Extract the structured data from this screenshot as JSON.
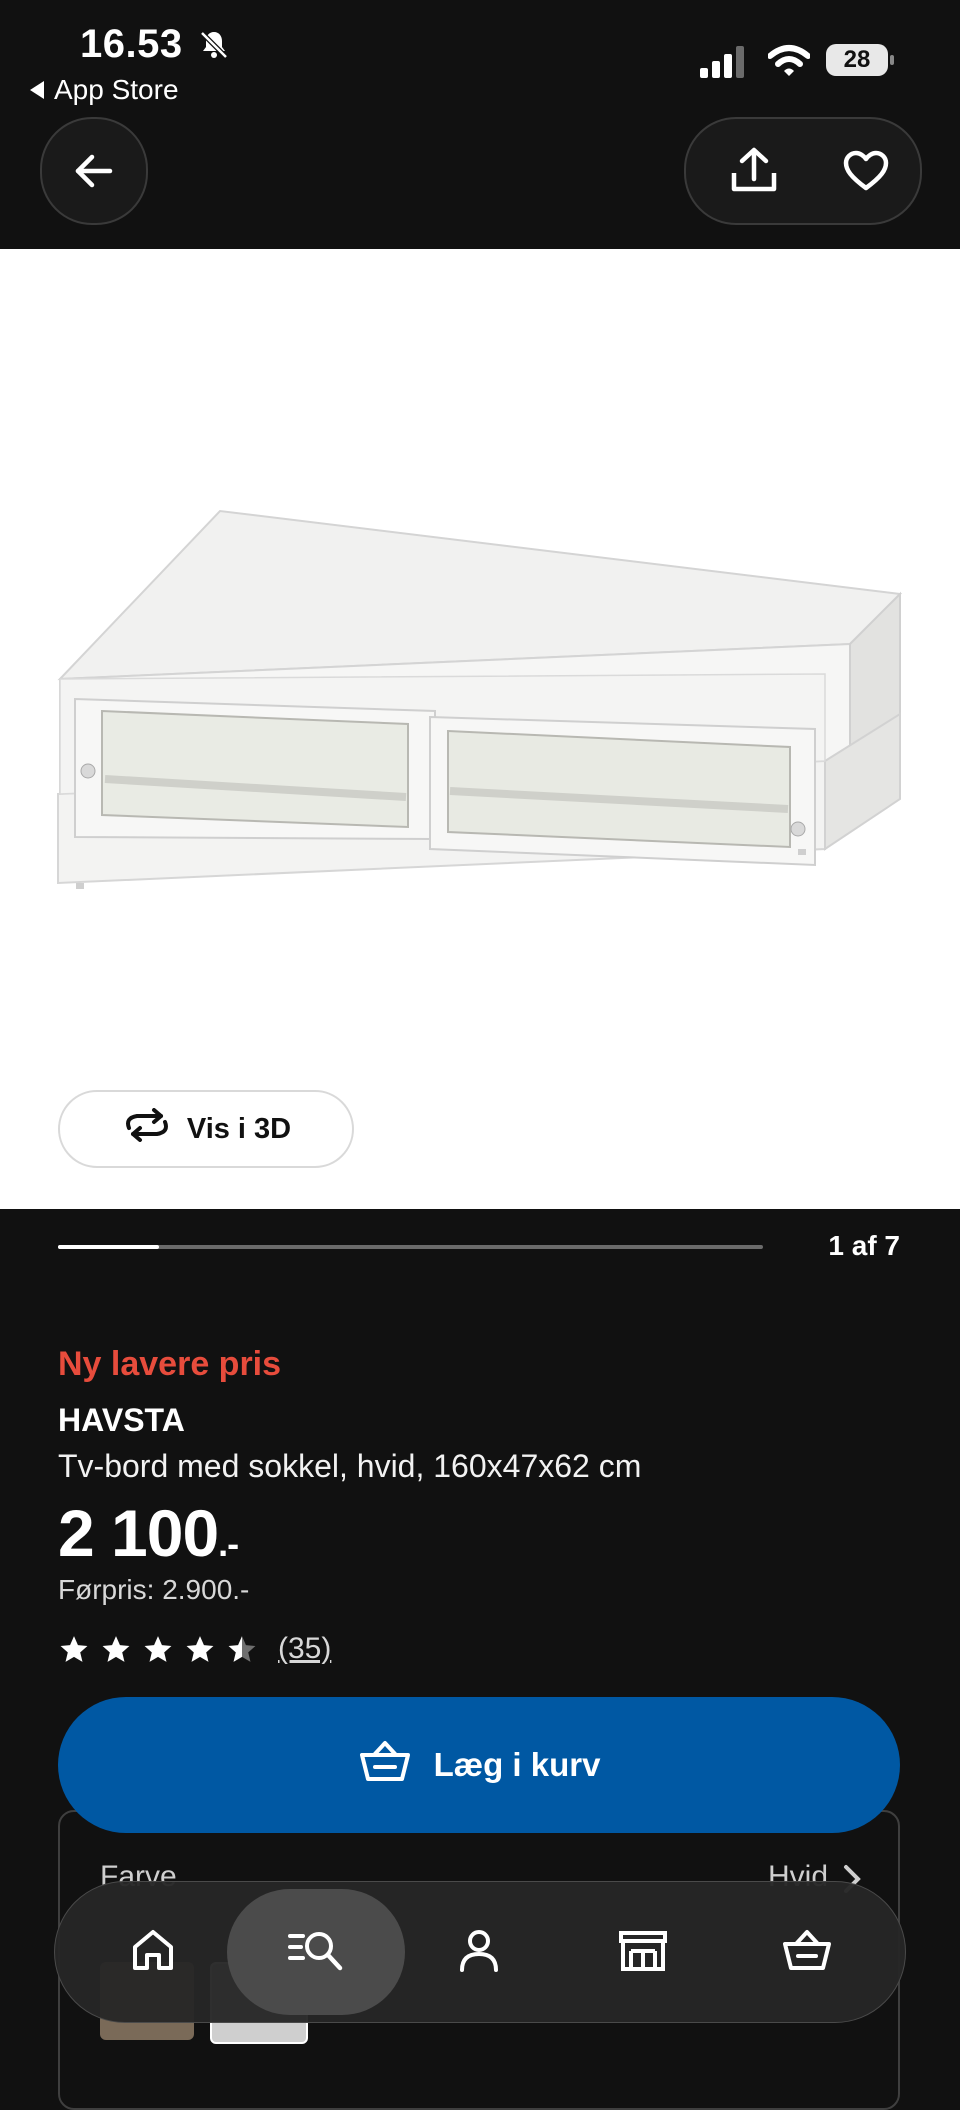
{
  "status": {
    "time": "16.53",
    "back_app": "App Store",
    "battery": "28"
  },
  "icons": {
    "back": "arrow-left-icon",
    "share": "share-icon",
    "favorite": "heart-icon",
    "view3d": "rotate-icon",
    "cart": "basket-icon"
  },
  "gallery": {
    "view3d_label": "Vis i 3D",
    "counter": "1 af 7",
    "progress_fraction": 0.143
  },
  "product": {
    "promo": "Ny lavere pris",
    "name": "HAVSTA",
    "description": "Tv-bord med sokkel, hvid, 160x47x62 cm",
    "price": "2 100",
    "price_suffix": ".-",
    "previous_price": "Førpris: 2.900.-",
    "rating_value": 4.5,
    "rating_max": 5,
    "review_count": "(35)"
  },
  "cart": {
    "label": "Læg i kurv"
  },
  "variant": {
    "label": "Farve",
    "value": "Hvid"
  },
  "tabbar": {
    "items": [
      "home",
      "search",
      "profile",
      "store",
      "cart"
    ],
    "active": "search"
  },
  "colors": {
    "background": "#111111",
    "promo": "#e74c3c",
    "primary_button": "#0058a3"
  }
}
